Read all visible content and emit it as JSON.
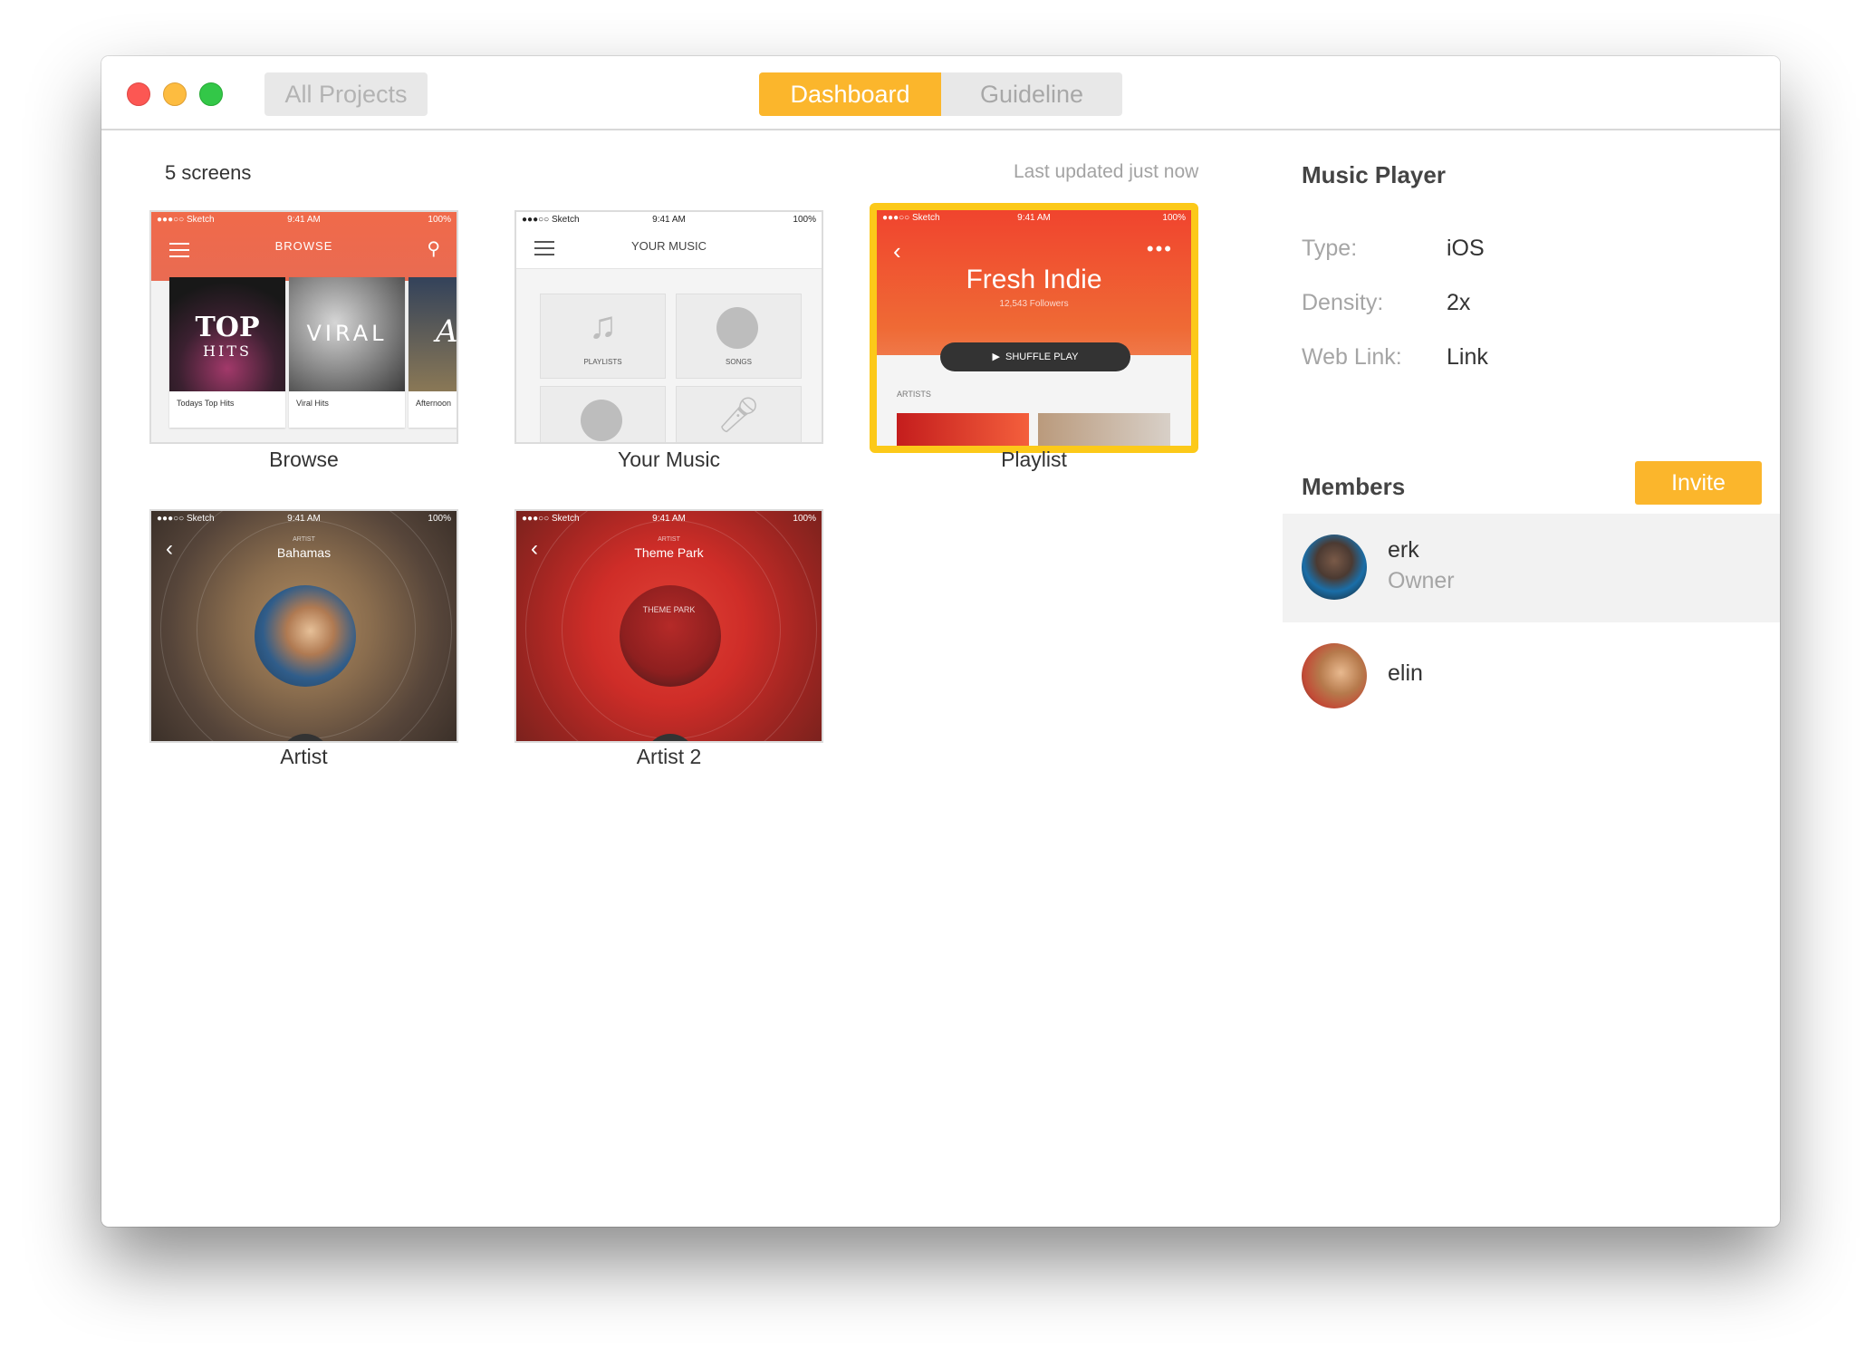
{
  "window": {
    "all_projects_label": "All Projects",
    "tabs": [
      {
        "label": "Dashboard",
        "active": true
      },
      {
        "label": "Guideline",
        "active": false
      }
    ],
    "accent_color": "#fbb62c",
    "selection_color": "#fcc919"
  },
  "screens": {
    "count_label": "5 screens",
    "last_updated": "Last updated just now",
    "items": [
      {
        "label": "Browse",
        "status_left": "●●●○○ Sketch",
        "status_time": "9:41 AM",
        "status_right": "100%",
        "header": "BROWSE",
        "albums": [
          {
            "art_text": "TOP",
            "art_sub": "HITS",
            "caption": "Todays Top Hits"
          },
          {
            "art_text": "VIRAL",
            "caption": "Viral Hits"
          },
          {
            "art_text": "A",
            "caption": "Afternoon"
          }
        ]
      },
      {
        "label": "Your Music",
        "status_left": "●●●○○ Sketch",
        "status_time": "9:41 AM",
        "status_right": "100%",
        "header": "YOUR MUSIC",
        "tiles": [
          "PLAYLISTS",
          "SONGS"
        ]
      },
      {
        "label": "Playlist",
        "selected": true,
        "status_left": "●●●○○ Sketch",
        "status_time": "9:41 AM",
        "status_right": "100%",
        "title": "Fresh Indie",
        "followers": "12,543 Followers",
        "shuffle": "SHUFFLE PLAY",
        "section": "ARTISTS"
      },
      {
        "label": "Artist",
        "status_left": "●●●○○ Sketch",
        "status_time": "9:41 AM",
        "status_right": "100%",
        "small": "ARTIST",
        "name": "Bahamas"
      },
      {
        "label": "Artist 2",
        "status_left": "●●●○○ Sketch",
        "status_time": "9:41 AM",
        "status_right": "100%",
        "small": "ARTIST",
        "name": "Theme Park",
        "tag": "THEME PARK"
      }
    ]
  },
  "project": {
    "title": "Music Player",
    "meta": [
      {
        "key": "Type:",
        "value": "iOS"
      },
      {
        "key": "Density:",
        "value": "2x"
      },
      {
        "key": "Web Link:",
        "value": "Link"
      }
    ]
  },
  "members": {
    "title": "Members",
    "invite_label": "Invite",
    "list": [
      {
        "name": "erk",
        "role": "Owner",
        "highlighted": true
      },
      {
        "name": "elin",
        "role": "",
        "highlighted": false
      }
    ]
  }
}
